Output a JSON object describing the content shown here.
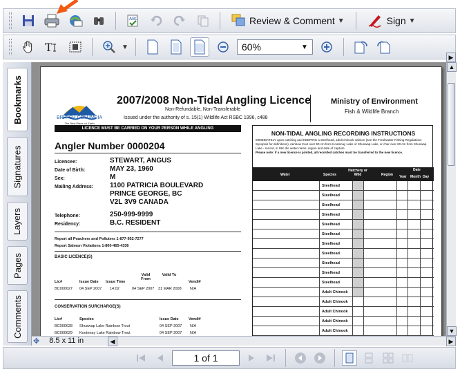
{
  "toolbar1": {
    "review_label": "Review & Comment",
    "sign_label": "Sign",
    "icons": [
      "save-icon",
      "print-icon",
      "email-icon",
      "search-icon",
      "spellcheck-icon",
      "undo-icon",
      "redo-icon",
      "copy-icon",
      "review-comment-icon",
      "sign-pen-icon"
    ]
  },
  "toolbar2": {
    "zoom_value": "60%",
    "icons": [
      "hand-tool-icon",
      "select-text-icon",
      "snapshot-icon",
      "zoom-in-icon",
      "actual-size-icon",
      "fit-page-icon",
      "fit-width-icon",
      "zoom-out-icon",
      "zoom-plus-icon",
      "rotate-cw-icon",
      "rotate-ccw-icon"
    ]
  },
  "side_tabs": [
    {
      "label": "Bookmarks",
      "active": true
    },
    {
      "label": "Signatures",
      "active": false
    },
    {
      "label": "Layers",
      "active": false
    },
    {
      "label": "Pages",
      "active": false
    },
    {
      "label": "Comments",
      "active": false
    }
  ],
  "status": {
    "page_size": "8.5 x 11 in"
  },
  "navigation": {
    "page_indicator": "1 of 1"
  },
  "document": {
    "title": "2007/2008 Non-Tidal Angling Licence",
    "subtitle1": "Non-Refundable, Non-Transferable",
    "subtitle2": "Issued under the authority of s. 15(1) Wildlife Act RSBC 1996, c488",
    "ministry": "Ministry of Environment",
    "branch": "Fish & Wildlife Branch",
    "logo_text": "BRITISH COLUMBIA",
    "logo_tagline": "The Best Place on Earth",
    "banner": "LICENCE MUST BE CARRIED ON YOUR PERSON WHILE ANGLING",
    "angler_number": "Angler Number  0000204",
    "fields": [
      {
        "label": "Licencee:",
        "value": "STEWART, ANGUS"
      },
      {
        "label": "Date of Birth:",
        "value": "MAY 23, 1960"
      },
      {
        "label": "Sex:",
        "value": "M"
      },
      {
        "label": "Mailing Address:",
        "value": "1100 PATRICIA BOULEVARD"
      },
      {
        "label": "",
        "value": "PRINCE GEORGE, BC"
      },
      {
        "label": "",
        "value": "V2L 3V9 CANADA"
      },
      {
        "label": "Telephone:",
        "value": "250-999-9999"
      },
      {
        "label": "Residency:",
        "value": "B.C. RESIDENT"
      }
    ],
    "report1": "Report all Poachers and Polluters  1-877-952-7277",
    "report2": "Report Salmon Violations  1-800-465-4336",
    "basic_heading": "BASIC LICENCE(S)",
    "basic_cols": [
      "Lic#",
      "Issue Date",
      "Issue Time",
      "Valid From",
      "Valid To",
      "Vendi#"
    ],
    "basic_row": [
      "BC000627",
      "04 SEP 2007",
      "14:02",
      "04 SEP 2007",
      "31 MAR 2008",
      "N/A"
    ],
    "surcharge_heading": "CONSERVATION SURCHARGE(S)",
    "surcharge_cols": [
      "Lic#",
      "Species",
      "Issue Date",
      "Vendi#"
    ],
    "surcharge_rows": [
      [
        "BC000628",
        "Shuswap Lake Rainbow Trout",
        "04 SEP 2007",
        "N/A"
      ],
      [
        "BC000629",
        "Kootenay Lake Rainbow Trout",
        "04 SEP 2007",
        "N/A"
      ]
    ],
    "rec_title": "NON-TIDAL ANGLING RECORDING INSTRUCTIONS",
    "rec_text": "IMMEDIATELY upon catching and KEEPING a steelhead, adult chinook salmon (see the Freshwater Fishing Regulations Synopsis for definitions), rainbow trout over 50 cm from Kootenay Lake or Shuswap Lake, or char over 60 cm from Shuswap Lake - record, in INK the water name, region and date of capture.",
    "rec_note": "Please note: if a new licence is printed, all recorded catches must be transferred to the new licence.",
    "rec_cols": {
      "water": "Water",
      "species": "Species",
      "hatchery": "Hatchery or Wild",
      "region": "Region",
      "date": "Date",
      "year": "Year",
      "month": "Month",
      "day": "Day"
    },
    "rec_species": [
      "Steelhead",
      "Steelhead",
      "Steelhead",
      "Steelhead",
      "Steelhead",
      "Steelhead",
      "Steelhead",
      "Steelhead",
      "Steelhead",
      "Steelhead",
      "Steelhead",
      "Adult Chinook",
      "Adult Chinook",
      "Adult Chinook",
      "Adult Chinook",
      "Adult Chinook",
      "Adult Chinook"
    ]
  },
  "colors": {
    "annotation_arrow": "#f25a12",
    "toolbar_top": "#f6f7f9",
    "doc_background": "#8f8f8f"
  }
}
